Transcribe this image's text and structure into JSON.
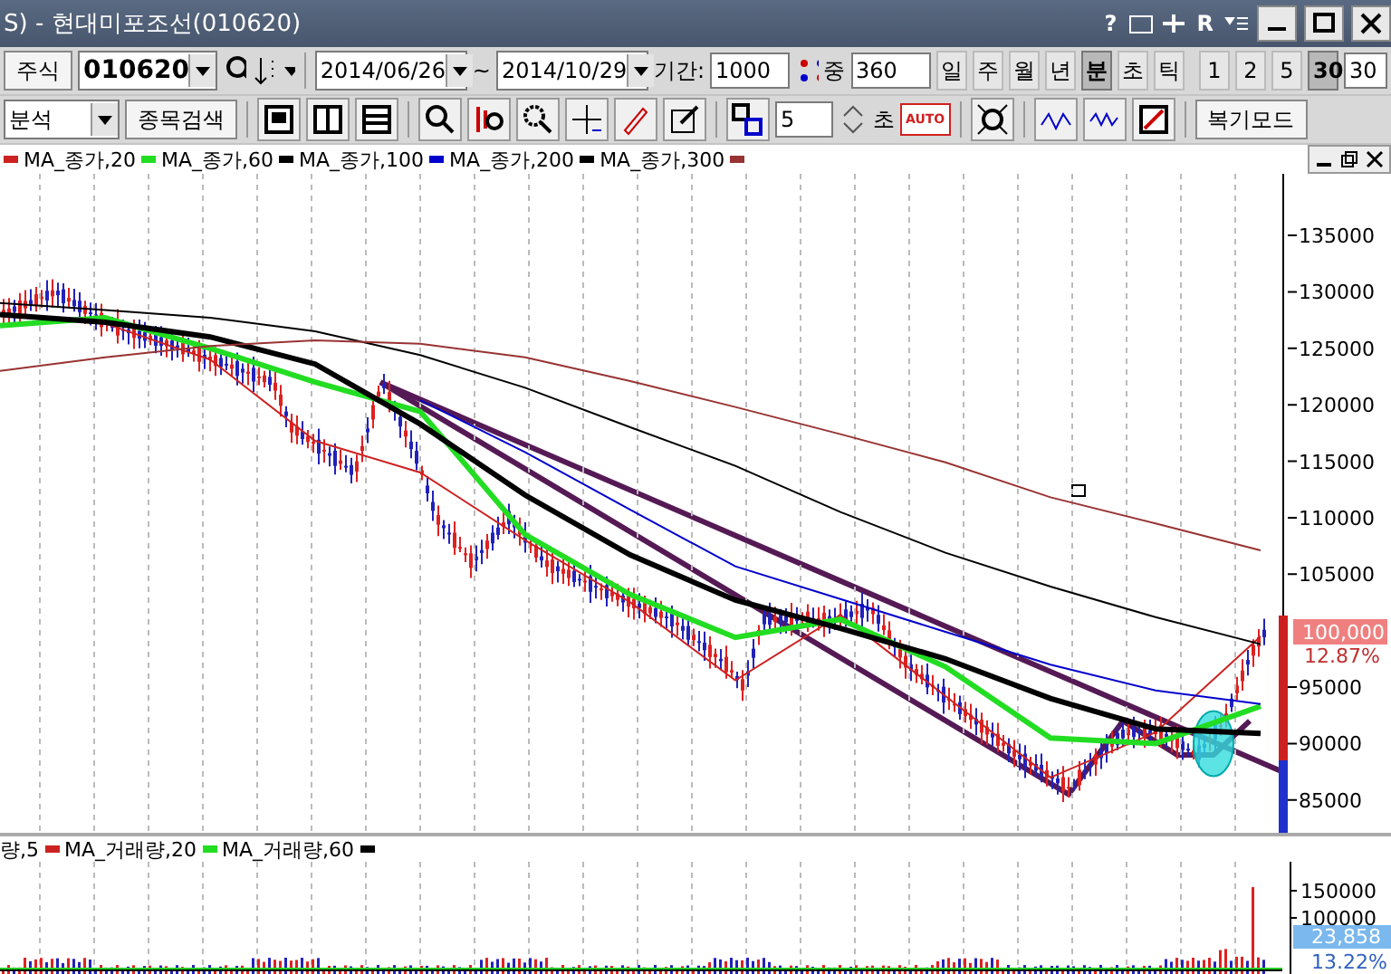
{
  "window": {
    "title": "S) - 현대미포조선(010620)",
    "help": "?",
    "r_label": "R"
  },
  "toolbar": {
    "market": "주식",
    "code": "010620",
    "date_from": "2014/06/26",
    "tilde": "~",
    "date_to": "2014/10/29",
    "period_label": "기간:",
    "period": "1000",
    "mid_label": "중",
    "mid_value": "360",
    "timeframes": [
      {
        "label": "일",
        "selected": false
      },
      {
        "label": "주",
        "selected": false
      },
      {
        "label": "월",
        "selected": false
      },
      {
        "label": "년",
        "selected": false
      },
      {
        "label": "분",
        "selected": true
      },
      {
        "label": "초",
        "selected": false
      },
      {
        "label": "틱",
        "selected": false
      }
    ],
    "intervals": [
      {
        "label": "1",
        "selected": false
      },
      {
        "label": "2",
        "selected": false
      },
      {
        "label": "5",
        "selected": false
      },
      {
        "label": "30",
        "selected": true
      }
    ],
    "interval_input": "30"
  },
  "toolbar2": {
    "analysis": "분석",
    "search_button": "종목검색",
    "step": "5",
    "step_unit": "초",
    "auto": "AUTO",
    "replay_button": "복기모드"
  },
  "price_chart": {
    "current": "100,000",
    "change": "12.87%",
    "chart_data": {
      "type": "line",
      "grid": true,
      "ylim": [
        82100,
        140450
      ],
      "yticks": [
        135000,
        130000,
        125000,
        120000,
        115000,
        110000,
        105000,
        95000,
        90000,
        85000
      ],
      "series": [
        {
          "name": "MA_종가,20",
          "color": "#cc2222",
          "values": [
            128000,
            127200,
            124000,
            116800,
            114000,
            108000,
            102500,
            95600,
            101400,
            94200,
            87000,
            91000,
            99500
          ]
        },
        {
          "name": "MA_종가,60",
          "color": "#22dd22",
          "values": [
            127000,
            127700,
            125000,
            122000,
            119400,
            108500,
            103200,
            99400,
            101000,
            96800,
            90500,
            90000,
            93300
          ]
        },
        {
          "name": "MA_종가,100",
          "color": "#000000",
          "values": [
            128000,
            127300,
            126000,
            123600,
            118300,
            112000,
            106700,
            102700,
            100200,
            97500,
            94000,
            91300,
            90900
          ]
        },
        {
          "name": "MA_종가,200",
          "color": "#0000cc",
          "values": [
            null,
            null,
            null,
            null,
            120400,
            115800,
            110700,
            105700,
            102800,
            99900,
            97000,
            94700,
            93500
          ]
        },
        {
          "name": "MA_종가,300",
          "color": "#000000",
          "values": [
            129000,
            128400,
            127700,
            126500,
            124400,
            121500,
            118000,
            114600,
            110500,
            106900,
            103900,
            101200,
            98800
          ]
        },
        {
          "color": "#993333",
          "values": [
            123000,
            124200,
            125200,
            125700,
            125400,
            124200,
            122100,
            119800,
            117400,
            114900,
            111800,
            109500,
            107100
          ]
        }
      ]
    }
  },
  "volume_legend": {
    "items": [
      {
        "label": "량,5"
      },
      {
        "label": "MA_거래량,20",
        "color": "#cc2222"
      },
      {
        "label": "MA_거래량,60",
        "color": "#22dd22"
      },
      {
        "color": "#000000"
      }
    ]
  },
  "volume_axis": {
    "ticks": [
      "150000",
      "100000"
    ],
    "current": "23,858",
    "change": "13.22%"
  }
}
